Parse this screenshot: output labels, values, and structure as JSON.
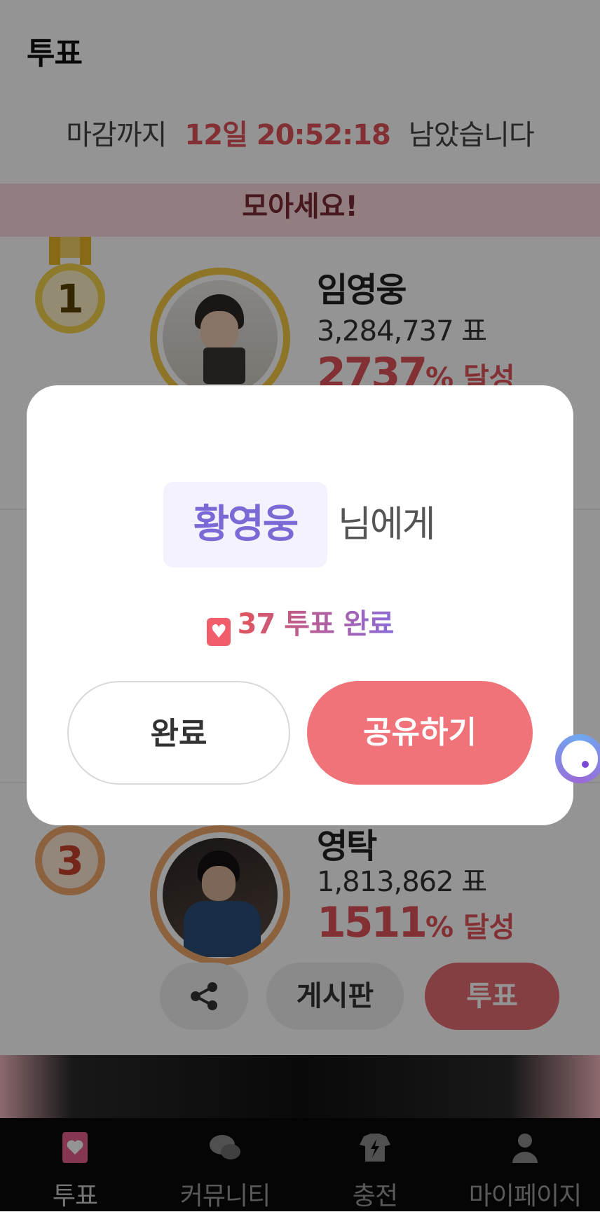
{
  "header": {
    "title": "투표"
  },
  "timer": {
    "prefix": "마감까지",
    "time": "12일 20:52:18",
    "suffix": "남았습니다"
  },
  "banner": {
    "text": "모아세요!"
  },
  "candidates": [
    {
      "rank": "1",
      "name": "임영웅",
      "votes": "3,284,737 표",
      "percent": "2737",
      "percent_suffix": "% 달성"
    },
    {
      "rank": "3",
      "name": "영탁",
      "votes": "1,813,862 표",
      "percent": "1511",
      "percent_suffix": "% 달성"
    }
  ],
  "card_actions": {
    "board_label": "게시판",
    "vote_label": "투표"
  },
  "modal": {
    "recipient": "황영웅",
    "recipient_suffix": "님에게",
    "done_message": "37 투표 완료",
    "complete_button": "완료",
    "share_button": "공유하기"
  },
  "tabbar": {
    "items": [
      {
        "label": "투표",
        "icon": "vote-heart-icon"
      },
      {
        "label": "커뮤니티",
        "icon": "chat-bubbles-icon"
      },
      {
        "label": "충전",
        "icon": "charge-shirt-icon"
      },
      {
        "label": "마이페이지",
        "icon": "person-icon"
      }
    ]
  },
  "colors": {
    "accent": "#e0545b",
    "share": "#f07379",
    "recipient": "#7b6ad6"
  }
}
